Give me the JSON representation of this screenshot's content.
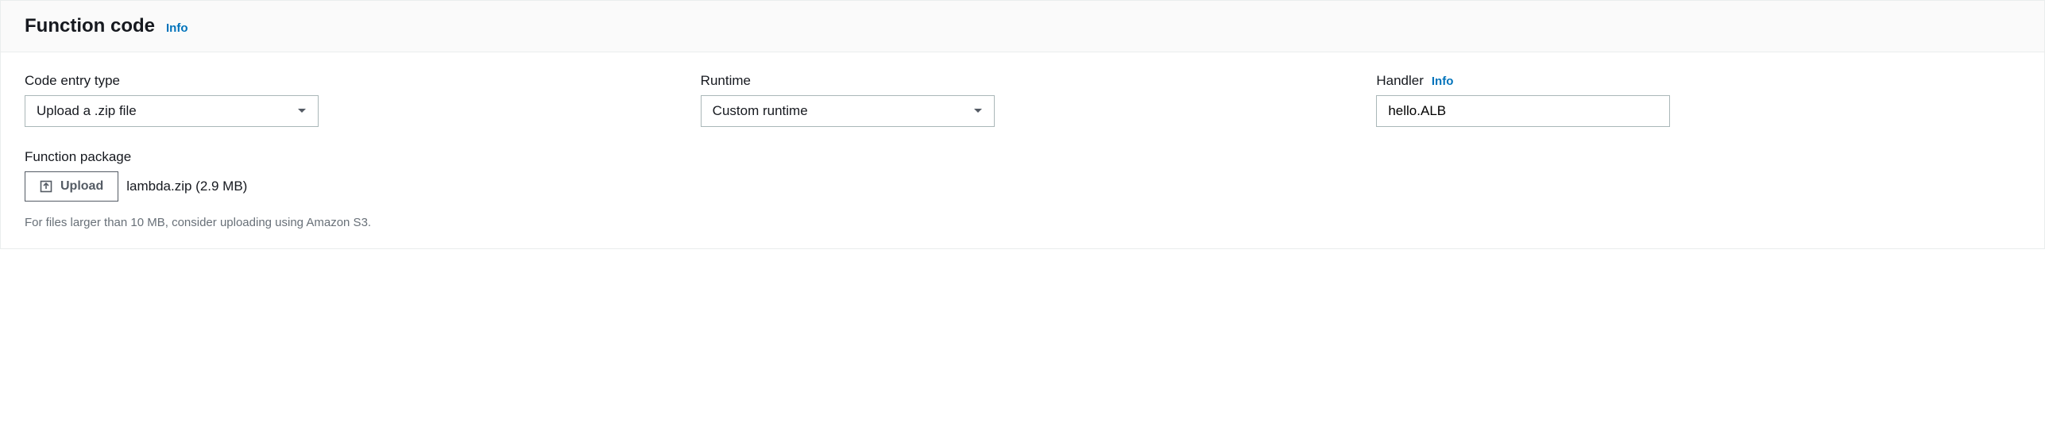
{
  "header": {
    "title": "Function code",
    "info_label": "Info"
  },
  "fields": {
    "code_entry_type": {
      "label": "Code entry type",
      "value": "Upload a .zip file"
    },
    "runtime": {
      "label": "Runtime",
      "value": "Custom runtime"
    },
    "handler": {
      "label": "Handler",
      "info_label": "Info",
      "value": "hello.ALB"
    }
  },
  "function_package": {
    "label": "Function package",
    "upload_button": "Upload",
    "file_info": "lambda.zip (2.9 MB)",
    "hint": "For files larger than 10 MB, consider uploading using Amazon S3."
  }
}
